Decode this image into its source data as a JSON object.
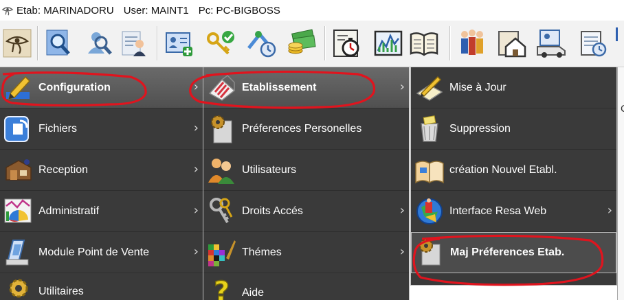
{
  "titlebar": {
    "etab_label": "Etab: MARINADORU",
    "user_label": "User: MAINT1",
    "pc_label": "Pc: PC-BIGBOSS"
  },
  "toolbar": {
    "buttons": [
      {
        "icon": "eye-of-horus-icon"
      },
      {
        "icon": "search-document-icon"
      },
      {
        "icon": "search-user-icon"
      },
      {
        "icon": "user-profile-icon"
      },
      {
        "icon": "add-card-icon"
      },
      {
        "icon": "keys-check-icon"
      },
      {
        "icon": "user-clock-icon"
      },
      {
        "icon": "money-coins-icon"
      },
      {
        "icon": "stopwatch-icon"
      },
      {
        "icon": "stats-chart-icon"
      },
      {
        "icon": "open-book-icon"
      },
      {
        "icon": "people-group-icon"
      },
      {
        "icon": "house-icon"
      },
      {
        "icon": "van-icon"
      },
      {
        "icon": "calendar-clock-icon"
      }
    ]
  },
  "menu1": {
    "items": [
      {
        "label": "Configuration",
        "icon": "pencil-icon"
      },
      {
        "label": "Fichiers",
        "icon": "files-icon"
      },
      {
        "label": "Reception",
        "icon": "desk-icon"
      },
      {
        "label": "Administratif",
        "icon": "chart-icon"
      },
      {
        "label": "Module Point de Vente",
        "icon": "pos-icon"
      },
      {
        "label": "Utilitaires",
        "icon": "gear-icon"
      }
    ]
  },
  "menu2": {
    "items": [
      {
        "label": "Etablissement",
        "icon": "building-icon"
      },
      {
        "label": "Préferences Personelles",
        "icon": "preferences-icon"
      },
      {
        "label": "Utilisateurs",
        "icon": "users-icon"
      },
      {
        "label": "Droits Accés",
        "icon": "keys-icon"
      },
      {
        "label": "Thémes",
        "icon": "palette-icon"
      },
      {
        "label": "Aide",
        "icon": "help-icon"
      }
    ]
  },
  "menu3": {
    "items": [
      {
        "label": "Mise à Jour",
        "icon": "edit-icon"
      },
      {
        "label": "Suppression",
        "icon": "trash-icon"
      },
      {
        "label": "création Nouvel Etabl.",
        "icon": "new-book-icon"
      },
      {
        "label": "Interface Resa Web",
        "icon": "globe-icon"
      },
      {
        "label": "Maj Préferences Etab.",
        "icon": "preferences-icon"
      }
    ]
  },
  "side_pane": {
    "fragment": "C"
  },
  "colors": {
    "menu_bg": "#3a3a3a",
    "annotation": "#e0141e"
  }
}
